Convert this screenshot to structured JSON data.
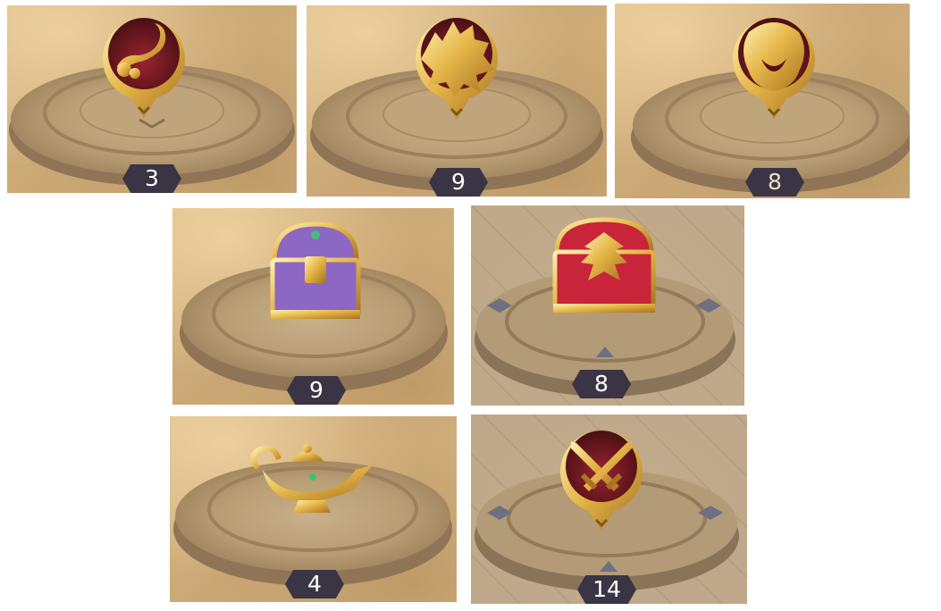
{
  "tiles": [
    {
      "id": "scorpion-altar",
      "icon": "scorpion-icon",
      "count": "3"
    },
    {
      "id": "wolf-altar",
      "icon": "wolf-head-icon",
      "count": "9"
    },
    {
      "id": "lion-altar",
      "icon": "lion-head-icon",
      "count": "8"
    },
    {
      "id": "purple-chest-altar",
      "icon": "purple-treasure-chest-icon",
      "count": "9"
    },
    {
      "id": "red-chest-altar",
      "icon": "red-dragon-chest-icon",
      "count": "8"
    },
    {
      "id": "lamp-altar",
      "icon": "magic-lamp-icon",
      "count": "4"
    },
    {
      "id": "swords-altar",
      "icon": "crossed-swords-icon",
      "count": "14"
    }
  ],
  "colors": {
    "badge": "#3a3444",
    "medallion_gold": "#e2b64a",
    "medallion_red": "#7a1a22",
    "chest_purple": "#8d67c4",
    "chest_red": "#c8243a"
  }
}
